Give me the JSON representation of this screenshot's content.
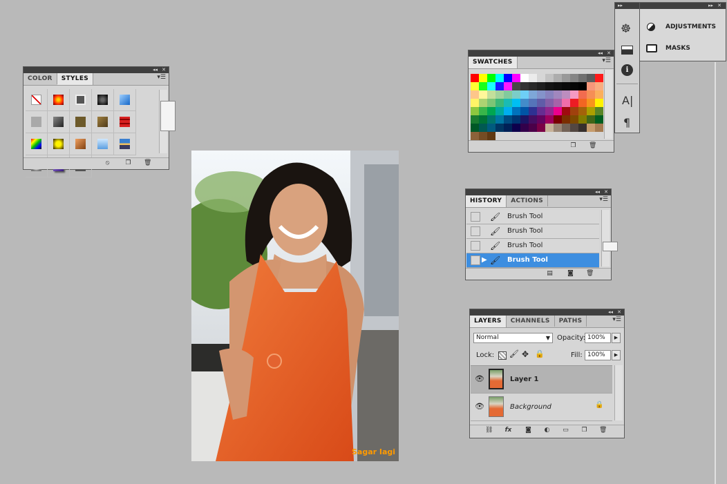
{
  "styles_panel": {
    "tabs": [
      "COLOR",
      "STYLES"
    ],
    "active_tab": "STYLES",
    "swatch_icons": [
      "none-style-icon",
      "red-glow-style-icon",
      "gray-button-style-icon",
      "dark-chrome-style-icon",
      "blue-glass-style-icon",
      "light-gray-style-icon",
      "dark-bevel-style-icon",
      "olive-texture-style-icon",
      "bronze-texture-style-icon",
      "red-stripe-style-icon",
      "rainbow-style-icon",
      "yellow-star-style-icon",
      "copper-style-icon",
      "sky-blue-style-icon",
      "landscape-style-icon",
      "gear-texture-style-icon",
      "purple-shadow-style-icon",
      "dark-gray-style-icon"
    ]
  },
  "swatches_panel": {
    "tabs": [
      "SWATCHES"
    ],
    "swatch_colors": [
      "#ff0000",
      "#ffff00",
      "#00ff00",
      "#00ffff",
      "#0000ff",
      "#ff00ff",
      "#ffffff",
      "#ebebeb",
      "#d6d6d6",
      "#c2c2c2",
      "#adadad",
      "#999999",
      "#858585",
      "#707070",
      "#5c5c5c",
      "#ff1a1a",
      "#ffff33",
      "#1aff1a",
      "#1affff",
      "#1a1aff",
      "#ff1aff",
      "#474747",
      "#333333",
      "#292929",
      "#1f1f1f",
      "#141414",
      "#0f0f0f",
      "#0a0a0a",
      "#050505",
      "#000000",
      "#f7977a",
      "#f9ad81",
      "#fdc68a",
      "#fff79a",
      "#c4df9b",
      "#a2d39c",
      "#82ca9d",
      "#7bcdc8",
      "#6ecff6",
      "#7ea7d8",
      "#8493ca",
      "#8882be",
      "#a187be",
      "#bc8dbf",
      "#f49ac2",
      "#f26c4f",
      "#f68e55",
      "#fbaf5c",
      "#fff467",
      "#acd372",
      "#7cc576",
      "#3bb878",
      "#1abbb4",
      "#00bff3",
      "#438cca",
      "#5574b9",
      "#605ca8",
      "#855fa8",
      "#a763a8",
      "#f06eaa",
      "#ed1c24",
      "#f26522",
      "#f7941d",
      "#fff200",
      "#8dc73f",
      "#39b54a",
      "#00a651",
      "#00a99d",
      "#00aeef",
      "#0072bc",
      "#0054a6",
      "#2e3192",
      "#662d91",
      "#92278f",
      "#ec008c",
      "#9e0b0f",
      "#a0410d",
      "#a3620a",
      "#aba000",
      "#598527",
      "#1a7b30",
      "#007236",
      "#00746b",
      "#0076a3",
      "#004b80",
      "#003471",
      "#1b1464",
      "#440e62",
      "#630460",
      "#9e005d",
      "#790000",
      "#7b2e00",
      "#7d4900",
      "#827b00",
      "#406618",
      "#005e20",
      "#005826",
      "#005952",
      "#005b7f",
      "#003663",
      "#002157",
      "#0d004c",
      "#32004b",
      "#4b0049",
      "#7b0046",
      "#c7b299",
      "#998675",
      "#736357",
      "#534741",
      "#37302d",
      "#c69c6d",
      "#a67c52",
      "#8c6239",
      "#754c24",
      "#603913"
    ]
  },
  "side_dock": {
    "items": [
      {
        "icon": "adjustments-icon",
        "label": "ADJUSTMENTS"
      },
      {
        "icon": "masks-icon",
        "label": "MASKS"
      }
    ],
    "tool_icons": [
      "navigator-icon",
      "histogram-icon",
      "info-icon",
      "character-icon",
      "paragraph-icon"
    ]
  },
  "history_panel": {
    "tabs": [
      "HISTORY",
      "ACTIONS"
    ],
    "active_tab": "HISTORY",
    "rows": [
      {
        "label": "Brush Tool",
        "selected": false
      },
      {
        "label": "Brush Tool",
        "selected": false
      },
      {
        "label": "Brush Tool",
        "selected": false
      },
      {
        "label": "Brush Tool",
        "selected": true
      }
    ]
  },
  "layers_panel": {
    "tabs": [
      "LAYERS",
      "CHANNELS",
      "PATHS"
    ],
    "active_tab": "LAYERS",
    "blend_mode": "Normal",
    "opacity_label": "Opacity:",
    "opacity_value": "100%",
    "lock_label": "Lock:",
    "fill_label": "Fill:",
    "fill_value": "100%",
    "layers": [
      {
        "name": "Layer 1",
        "selected": true
      },
      {
        "name": "Background",
        "selected": false
      }
    ]
  },
  "canvas": {
    "watermark": "Sagar Iagi"
  }
}
